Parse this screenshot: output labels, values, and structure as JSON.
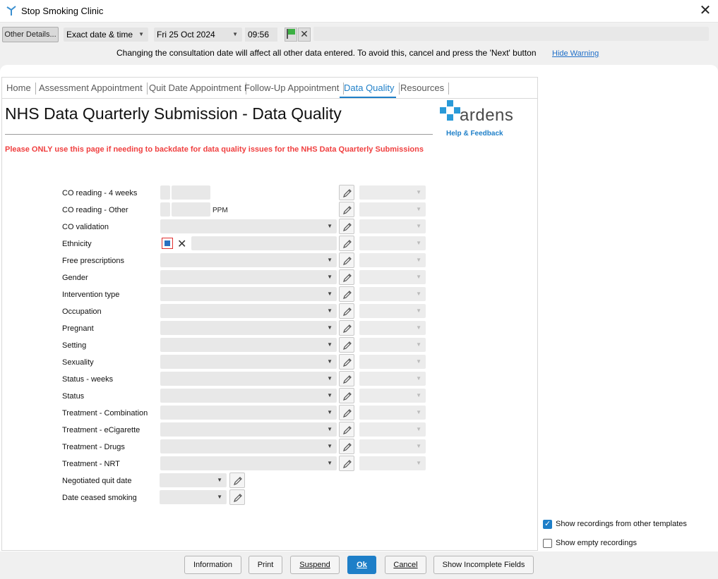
{
  "window": {
    "title": "Stop Smoking Clinic"
  },
  "toolbar": {
    "other_details": "Other Details...",
    "date_mode": "Exact date & time",
    "date": "Fri 25 Oct 2024",
    "time": "09:56",
    "warning": "Changing the consultation date will affect all other data entered. To avoid this, cancel and press the 'Next' button",
    "hide_warning": "Hide Warning"
  },
  "tabs": [
    "Home",
    "Assessment Appointment",
    "Quit Date Appointment",
    "Follow-Up Appointment",
    "Data Quality",
    "Resources"
  ],
  "active_tab": "Data Quality",
  "page": {
    "title": "NHS Data Quarterly Submission - Data Quality",
    "warning": "Please ONLY use this page if needing to backdate for data quality issues for the NHS Data Quarterly Submissions",
    "logo_text": "ardens",
    "logo_help": "Help & Feedback"
  },
  "form": {
    "ppm": "PPM",
    "rows": [
      "CO reading - 4 weeks",
      "CO reading - Other",
      "CO validation",
      "Ethnicity",
      "Free prescriptions",
      "Gender",
      "Intervention type",
      "Occupation",
      "Pregnant",
      "Setting",
      "Sexuality",
      "Status - weeks",
      "Status",
      "Treatment - Combination",
      "Treatment - eCigarette",
      "Treatment - Drugs",
      "Treatment - NRT",
      "Negotiated quit date",
      "Date ceased smoking"
    ]
  },
  "side": {
    "show_other": "Show recordings from other templates",
    "show_other_checked": true,
    "show_empty": "Show empty recordings",
    "show_empty_checked": false
  },
  "footer": {
    "information": "Information",
    "print": "Print",
    "suspend": "Suspend",
    "ok": "Ok",
    "cancel": "Cancel",
    "show_incomplete": "Show Incomplete Fields"
  },
  "colors": {
    "accent": "#1e7fc8",
    "warning_red": "#f04040"
  }
}
